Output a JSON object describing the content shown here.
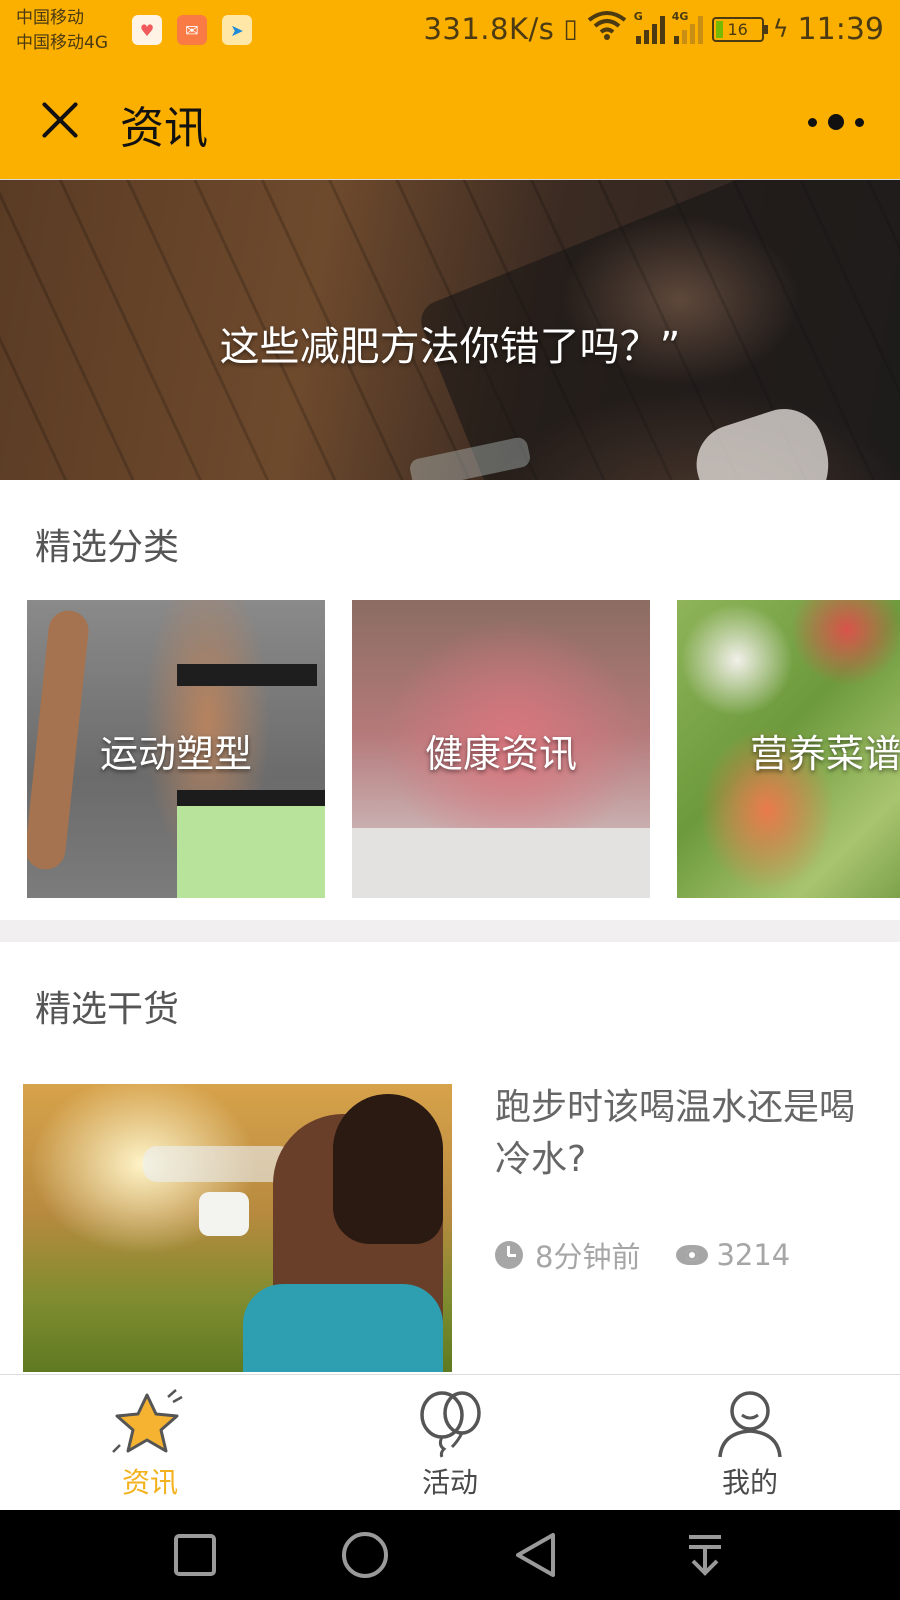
{
  "status_bar": {
    "carrier_1": "中国移动",
    "carrier_2": "中国移动4G",
    "net_speed": "331.8K/s",
    "signal_tag_1": "G",
    "signal_tag_2": "4G",
    "battery_level": "16",
    "time": "11:39"
  },
  "header": {
    "title": "资讯"
  },
  "banner": {
    "caption": "这些减肥方法你错了吗？”"
  },
  "categories": {
    "title": "精选分类",
    "items": [
      {
        "label": "运动塑型"
      },
      {
        "label": "健康资讯"
      },
      {
        "label": "营养菜谱"
      }
    ]
  },
  "featured": {
    "title": "精选干货",
    "articles": [
      {
        "title": "跑步时该喝温水还是喝冷水?",
        "time": "8分钟前",
        "views": "3214"
      }
    ]
  },
  "tab_bar": {
    "items": [
      {
        "label": "资讯",
        "icon": "star-icon",
        "active": true
      },
      {
        "label": "活动",
        "icon": "balloons-icon",
        "active": false
      },
      {
        "label": "我的",
        "icon": "user-icon",
        "active": false
      }
    ]
  },
  "colors": {
    "brand": "#fbb000",
    "active_tab": "#f3b21d",
    "meta_text": "#a6a6a6"
  }
}
